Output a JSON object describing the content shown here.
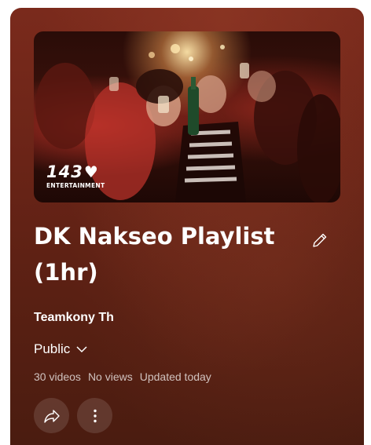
{
  "playlist": {
    "thumbnail_logo": {
      "number": "143",
      "subtitle": "ENTERTAINMENT"
    },
    "title": "DK Nakseo Playlist (1hr)",
    "channel": "Teamkony Th",
    "privacy": {
      "selected": "Public"
    },
    "stats": {
      "videos": "30 videos",
      "views": "No views",
      "updated": "Updated today"
    },
    "icons": {
      "edit": "pencil-icon",
      "privacy_toggle": "chevron-down-icon",
      "share": "share-icon",
      "more": "more-vert-icon"
    },
    "colors": {
      "card_top": "#7a2a1c",
      "card_bottom": "#4a1c10",
      "text_primary": "#ffffff",
      "text_secondary": "#d9c7c2"
    }
  }
}
